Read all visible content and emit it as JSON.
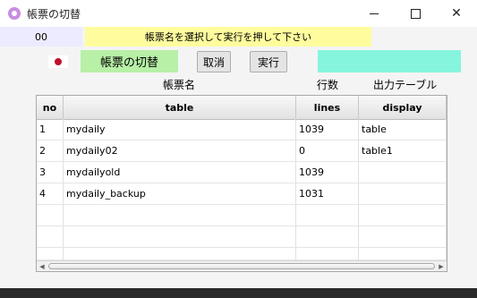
{
  "window": {
    "title": "帳票の切替",
    "accent": "#c98ee0"
  },
  "top": {
    "code": "00",
    "message": "帳票名を選択して実行を押して下さい"
  },
  "controls": {
    "form_name": "帳票の切替",
    "cancel_label": "取消",
    "execute_label": "実行"
  },
  "labels": {
    "form_name": "帳票名",
    "line_count": "行数",
    "output_table": "出力テーブル"
  },
  "table": {
    "columns": [
      "no",
      "table",
      "lines",
      "display"
    ],
    "rows": [
      {
        "no": "1",
        "table": "mydaily",
        "lines": "1039",
        "display": "table"
      },
      {
        "no": "2",
        "table": "mydaily02",
        "lines": "0",
        "display": "table1"
      },
      {
        "no": "3",
        "table": "mydailyold",
        "lines": "1039",
        "display": ""
      },
      {
        "no": "4",
        "table": "mydaily_backup",
        "lines": "1031",
        "display": ""
      }
    ],
    "empty_row_count": 3
  },
  "colors": {
    "code_bg": "#ecebff",
    "message_bg": "#fffc9e",
    "form_name_bg": "#b7f0a6",
    "status_bg": "#86f5de"
  }
}
